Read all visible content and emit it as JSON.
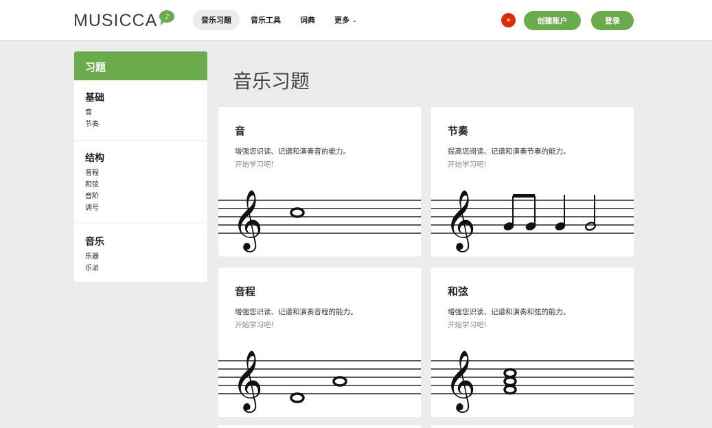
{
  "header": {
    "logo": "MUSICCA",
    "nav": [
      {
        "label": "音乐习题",
        "active": true
      },
      {
        "label": "音乐工具",
        "active": false
      },
      {
        "label": "词典",
        "active": false
      },
      {
        "label": "更多",
        "active": false,
        "chevron": "⌄"
      }
    ],
    "flag": "★",
    "create_account": "创建账户",
    "login": "登录"
  },
  "sidebar": {
    "title": "习题",
    "groups": [
      {
        "title": "基础",
        "items": [
          "音",
          "节奏"
        ]
      },
      {
        "title": "结构",
        "items": [
          "音程",
          "和弦",
          "音阶",
          "调号"
        ]
      },
      {
        "title": "音乐",
        "items": [
          "乐器",
          "乐派"
        ]
      }
    ]
  },
  "main": {
    "title": "音乐习题",
    "cards": [
      {
        "title": "音",
        "desc": "增强您识读、记谱和演奏音的能力。",
        "cta": "开始学习吧!"
      },
      {
        "title": "节奏",
        "desc": "提高您阅读、记谱和演奏节奏的能力。",
        "cta": "开始学习吧!"
      },
      {
        "title": "音程",
        "desc": "增强您识读、记谱和演奏音程的能力。",
        "cta": "开始学习吧!"
      },
      {
        "title": "和弦",
        "desc": "增强您识读、记谱和演奏和弦的能力。",
        "cta": "开始学习吧!"
      }
    ]
  },
  "colors": {
    "accent": "#6aab4c",
    "background": "#ececec"
  },
  "icons": {
    "clef": "treble-clef-icon",
    "logo_bubble": "speech-bubble-note-icon"
  }
}
